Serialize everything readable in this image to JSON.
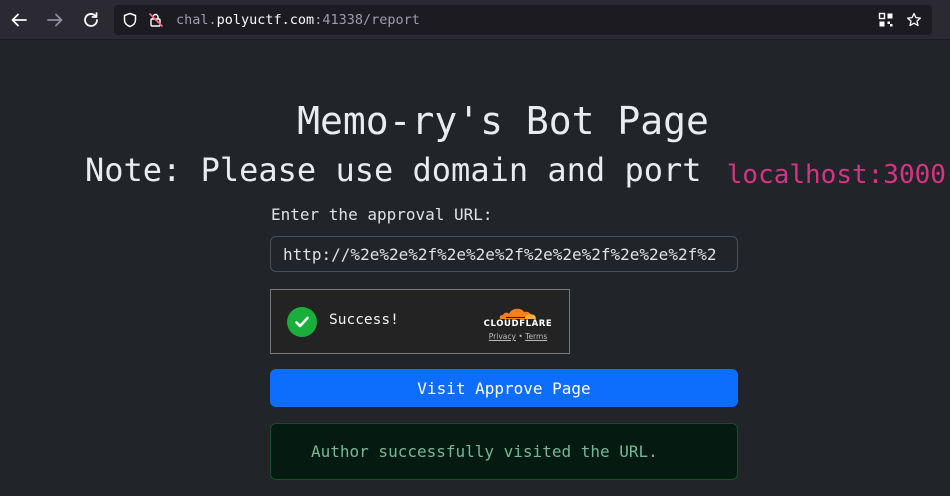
{
  "browser": {
    "url_prefix": "chal.",
    "url_domain": "polyuctf.com",
    "url_suffix": ":41338/report",
    "icons": [
      "back-arrow-icon",
      "forward-arrow-icon",
      "reload-icon",
      "shield-icon",
      "insecure-lock-icon",
      "qr-code-icon",
      "bookmark-star-icon"
    ]
  },
  "page": {
    "title": "Memo-ry's Bot Page",
    "note_text": "Note: Please use domain and port",
    "note_code": "localhost:3000",
    "form_label": "Enter the approval URL:",
    "url_value": "http://%2e%2e%2f%2e%2e%2f%2e%2e%2f%2e%2e%2f%2",
    "captcha": {
      "status": "Success!",
      "brand": "CLOUDFLARE",
      "privacy": "Privacy",
      "separator": "•",
      "terms": "Terms"
    },
    "visit_button": "Visit Approve Page",
    "alert_message": "Author successfully visited the URL."
  },
  "colors": {
    "background": "#212529",
    "primary": "#0d6efd",
    "code": "#d63384",
    "success": "#1aaf3a",
    "cloudflare_orange": "#f38020"
  }
}
